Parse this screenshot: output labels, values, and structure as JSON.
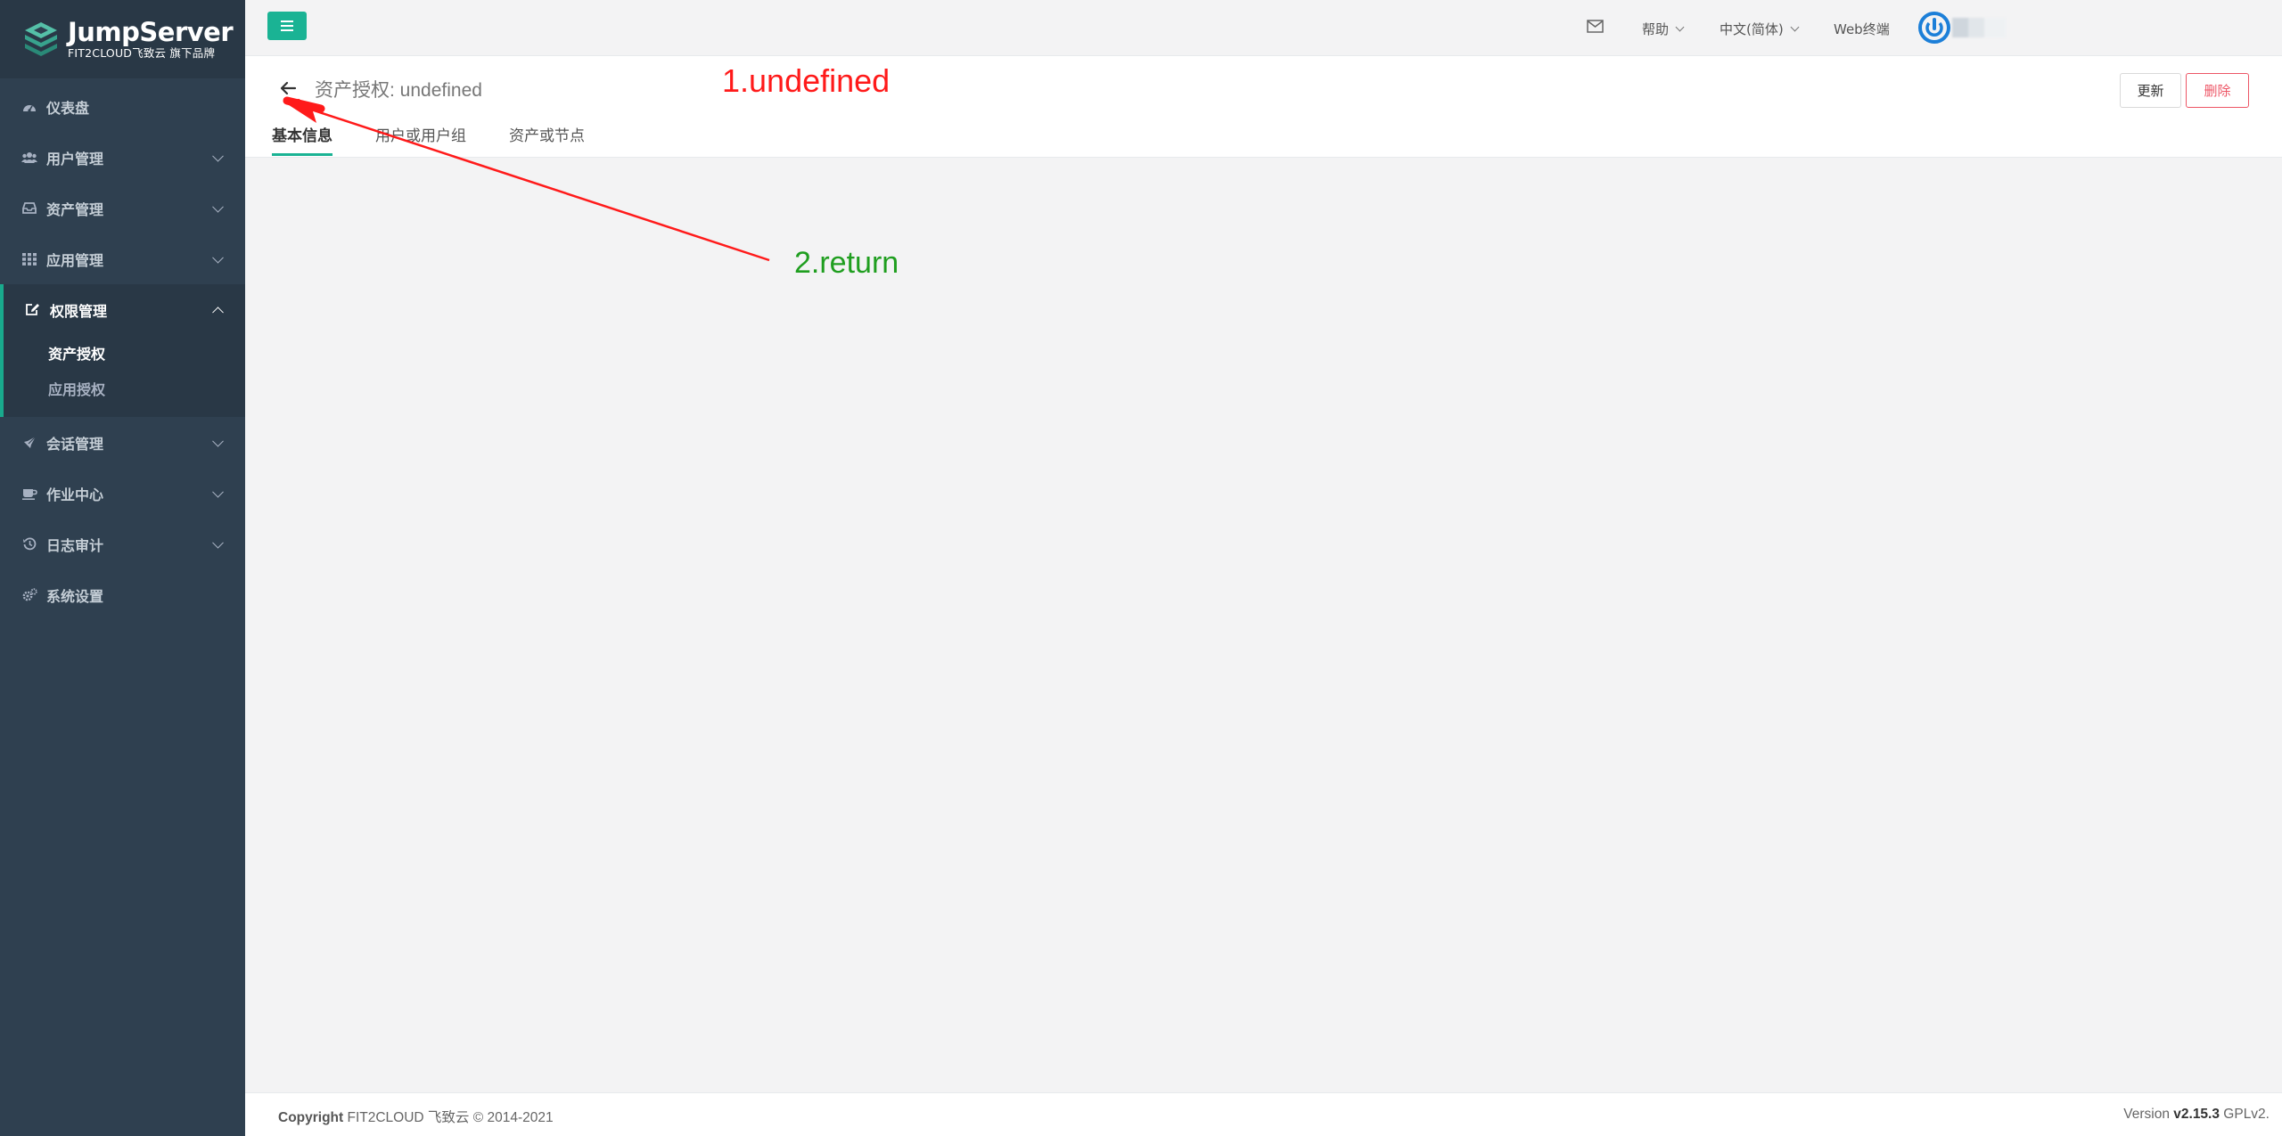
{
  "brand": {
    "name": "JumpServer",
    "subtitle": "FIT2CLOUD飞致云 旗下品牌"
  },
  "sidebar": {
    "items": [
      {
        "label": "仪表盘",
        "icon": "dashboard-icon"
      },
      {
        "label": "用户管理",
        "icon": "users-icon"
      },
      {
        "label": "资产管理",
        "icon": "inbox-icon"
      },
      {
        "label": "应用管理",
        "icon": "grid-icon"
      },
      {
        "label": "权限管理",
        "icon": "edit-icon",
        "children": [
          {
            "label": "资产授权"
          },
          {
            "label": "应用授权"
          }
        ]
      },
      {
        "label": "会话管理",
        "icon": "rocket-icon"
      },
      {
        "label": "作业中心",
        "icon": "coffee-icon"
      },
      {
        "label": "日志审计",
        "icon": "history-icon"
      },
      {
        "label": "系统设置",
        "icon": "cogs-icon"
      }
    ]
  },
  "topbar": {
    "help": "帮助",
    "language": "中文(简体)",
    "web_terminal": "Web终端"
  },
  "page": {
    "title": "资产授权: undefined",
    "tabs": [
      "基本信息",
      "用户或用户组",
      "资产或节点"
    ],
    "update_label": "更新",
    "delete_label": "删除"
  },
  "annotations": {
    "first": "1.undefined",
    "second": "2.return"
  },
  "footer": {
    "copyright_label": "Copyright",
    "copyright_text": "FIT2CLOUD 飞致云 © 2014-2021",
    "version_label": "Version",
    "version_number": "v2.15.3",
    "license": "GPLv2."
  },
  "colors": {
    "sidebar": "#2f4050",
    "accent": "#1ab394",
    "danger": "#ed5565",
    "annotation_red": "#ff1a1a",
    "annotation_green": "#1f9e1f"
  }
}
